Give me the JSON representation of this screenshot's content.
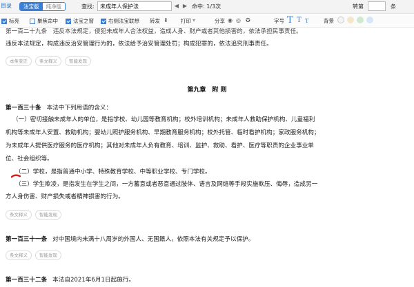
{
  "toolbar": {
    "menu_label": "目录",
    "view_mode_on": "法宝版",
    "view_mode_off": "纯净版",
    "find_label": "查找:",
    "find_value": "未成年人保护法",
    "hit_label": "命中: 1/3次",
    "goto_label": "转第",
    "goto_unit": "条"
  },
  "toolbar2": {
    "cb_title": "标亮",
    "cb_focus": "聚焦命中",
    "cb_fabao": "法宝之窗",
    "cb_right": "右侧法宝联想",
    "forward": "转发",
    "print": "打印",
    "share": "分享",
    "fontsize": "字号",
    "background": "背景",
    "bg_colors": [
      "#f4f4f4",
      "#f5e6c8",
      "#cfe9cf",
      "#d6e6f7"
    ]
  },
  "content": {
    "art129_tail": "第一百二十九条　违反本法规定，侵犯未成年人合法权益，造成人身、财产或者其他损害的，依法承担民事责任。",
    "art129_line2": "违反本法规定，构成违反治安管理行为的，依法给予治安管理处罚；构成犯罪的，依法追究刑事责任。",
    "tags1": [
      "本条变迁",
      "条文释义",
      "智能发现"
    ],
    "chapter": "第九章　附 则",
    "art130_no": "第一百三十条",
    "art130_head": "本法中下列用语的含义：",
    "art130_1_l1": "（一）密切接触未成年人的单位，是指学校、幼儿园等教育机构；校外培训机构；未成年人救助保护机构、儿童福利",
    "art130_1_l2": "机构等未成年人安置、救助机构；婴幼儿照护服务机构、早期教育服务机构；校外托管、临时看护机构；家政服务机构；",
    "art130_1_l3": "为未成年人提供医疗服务的医疗机构；其他对未成年人负有教育、培训、监护、救助、看护、医疗等职责的企业事业单",
    "art130_1_l4": "位、社会组织等。",
    "art130_2": "（二）学校，是指普通中小学、特殊教育学校、中等职业学校、专门学校。",
    "art130_3_l1": "（三）学生欺凌，是指发生在学生之间，一方蓄意或者恶意通过肢体、语言及网络等手段实施欺压、侮辱，造成另一",
    "art130_3_l2": "方人身伤害、财产损失或者精神损害的行为。",
    "tags2": [
      "条文释义",
      "智能发现"
    ],
    "art131_no": "第一百三十一条",
    "art131_text": "对中国境内未满十八周岁的外国人、无国籍人，依照本法有关规定予以保护。",
    "tags3": [
      "条文释义",
      "智能发现"
    ],
    "art132_no": "第一百三十二条",
    "art132_text": "本法自2021年6月1日起施行。"
  }
}
